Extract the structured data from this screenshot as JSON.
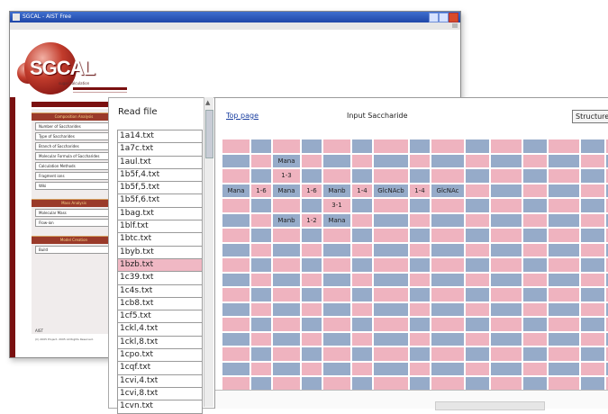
{
  "window": {
    "title": "SGCAL - AIST Free"
  },
  "logo": {
    "text": "SGCAL",
    "subtitle": "sugar calculation"
  },
  "nav": {
    "sections": [
      {
        "header": "Composition Analysis",
        "items": [
          "Number of Saccharides",
          "Type of Saccharides",
          "Branch of Saccharides",
          "Molecular Formula of Saccharides",
          "Calculation Methods",
          "Fragment ions",
          "Wiki"
        ]
      },
      {
        "header": "Mass Analysis",
        "items": [
          "Molecular Mass",
          "Flow-ion"
        ]
      },
      {
        "header": "Model Creation",
        "items": [
          "Build"
        ]
      }
    ],
    "aist": "AIST",
    "copyright": "(C) 2005 Project. 2005 All Rights Reserved."
  },
  "read_file": {
    "title": "Read file",
    "files": [
      "1a14.txt",
      "1a7c.txt",
      "1aul.txt",
      "1b5f,4.txt",
      "1b5f,5.txt",
      "1b5f,6.txt",
      "1bag.txt",
      "1blf.txt",
      "1btc.txt",
      "1byb.txt",
      "1bzb.txt",
      "1c39.txt",
      "1c4s.txt",
      "1cb8.txt",
      "1cf5.txt",
      "1ckl,4.txt",
      "1ckl,8.txt",
      "1cpo.txt",
      "1cqf.txt",
      "1cvi,4.txt",
      "1cvi,8.txt",
      "1cvn.txt"
    ],
    "selected": "1bzb.txt"
  },
  "panel": {
    "top_link": "Top page",
    "title": "Input Saccharide",
    "structure_button": "Structure"
  },
  "grid": {
    "rows": 18,
    "cols": 15,
    "colors": {
      "pink": "#efb3bf",
      "blue": "#96abc9"
    },
    "cells": [
      {
        "r": 1,
        "c": 2,
        "text": "Mana"
      },
      {
        "r": 2,
        "c": 2,
        "text": "1-3"
      },
      {
        "r": 3,
        "c": 0,
        "text": "Mana"
      },
      {
        "r": 3,
        "c": 1,
        "text": "1-6"
      },
      {
        "r": 3,
        "c": 2,
        "text": "Mana"
      },
      {
        "r": 3,
        "c": 3,
        "text": "1-6"
      },
      {
        "r": 3,
        "c": 4,
        "text": "Manb"
      },
      {
        "r": 3,
        "c": 5,
        "text": "1-4"
      },
      {
        "r": 3,
        "c": 6,
        "text": "GlcNAcb"
      },
      {
        "r": 3,
        "c": 7,
        "text": "1-4"
      },
      {
        "r": 3,
        "c": 8,
        "text": "GlcNAc"
      },
      {
        "r": 4,
        "c": 4,
        "text": "3-1"
      },
      {
        "r": 5,
        "c": 2,
        "text": "Manb"
      },
      {
        "r": 5,
        "c": 3,
        "text": "1-2"
      },
      {
        "r": 5,
        "c": 4,
        "text": "Mana"
      }
    ]
  }
}
